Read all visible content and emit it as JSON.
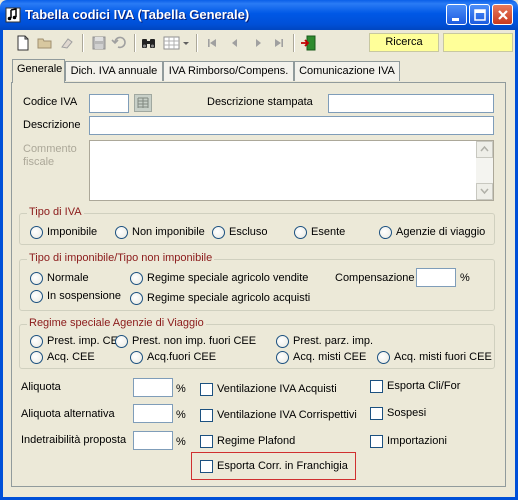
{
  "window": {
    "title": "Tabella codici IVA (Tabella Generale)"
  },
  "toolbar": {
    "ricerca_label": "Ricerca"
  },
  "tabs": [
    {
      "label": "Generale"
    },
    {
      "label": "Dich. IVA annuale"
    },
    {
      "label": "IVA Rimborso/Compens."
    },
    {
      "label": "Comunicazione IVA"
    }
  ],
  "form": {
    "codice_iva_label": "Codice IVA",
    "codice_iva_value": "",
    "descrizione_stampata_label": "Descrizione stampata",
    "descrizione_stampata_value": "",
    "descrizione_label": "Descrizione",
    "descrizione_value": "",
    "commento_label_1": "Commento",
    "commento_label_2": "fiscale",
    "commento_value": ""
  },
  "tipo_iva": {
    "title": "Tipo di IVA",
    "options": [
      "Imponibile",
      "Non imponibile",
      "Escluso",
      "Esente",
      "Agenzie di viaggio"
    ]
  },
  "tipo_imponibile": {
    "title": "Tipo di imponibile/Tipo non imponibile",
    "normale": "Normale",
    "in_sospensione": "In sospensione",
    "regime_vendite": "Regime speciale agricolo  vendite",
    "regime_acquisti": "Regime speciale agricolo  acquisti",
    "compensazione_label": "Compensazione",
    "compensazione_value": "",
    "percent": "%"
  },
  "regime_agenzie": {
    "title": "Regime speciale Agenzie di Viaggio",
    "options": [
      "Prest. imp. CEE",
      "Prest. non imp. fuori CEE",
      "Prest. parz. imp.",
      "Acq. CEE",
      "Acq.fuori CEE",
      "Acq. misti CEE",
      "Acq. misti fuori CEE"
    ]
  },
  "aliquote": {
    "aliquota_label": "Aliquota",
    "aliquota_value": "",
    "aliquota_alt_label": "Aliquota alternativa",
    "aliquota_alt_value": "",
    "indetraibilita_label": "Indetraibilità proposta",
    "indetraibilita_value": "",
    "percent": "%"
  },
  "checks": {
    "ventilazione_acquisti": "Ventilazione IVA Acquisti",
    "ventilazione_corrispettivi": "Ventilazione IVA Corrispettivi",
    "regime_plafond": "Regime Plafond",
    "esporta_cli_for": "Esporta Cli/For",
    "sospesi": "Sospesi",
    "importazioni": "Importazioni",
    "esporta_franchigia": "Esporta Corr. in Franchigia"
  }
}
